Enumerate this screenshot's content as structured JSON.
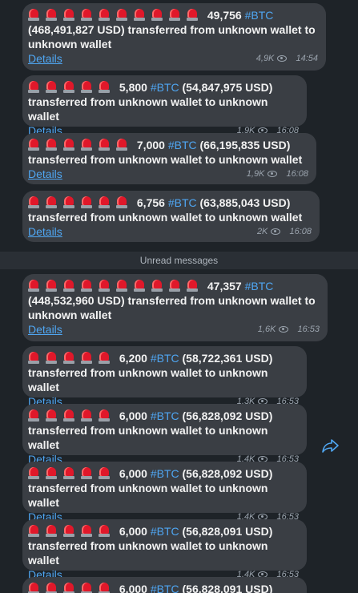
{
  "divider": "Unread messages",
  "messages": [
    {
      "sirens": 10,
      "amount": "49,756",
      "hashtag": "#BTC",
      "line1_rest": "",
      "line2": "(468,491,827 USD) transferred from unknown wallet to",
      "line3": "unknown wallet",
      "details": "Details",
      "views": "4,9K",
      "time": "14:54"
    },
    {
      "sirens": 5,
      "amount": "5,800",
      "hashtag": "#BTC",
      "line1_rest": "(54,847,975 USD)",
      "line2": "transferred from unknown wallet to unknown wallet",
      "details": "Details",
      "views": "1,9K",
      "time": "16:08"
    },
    {
      "sirens": 6,
      "amount": "7,000",
      "hashtag": "#BTC",
      "line1_rest": "(66,195,835 USD)",
      "line2": "transferred from unknown wallet to unknown wallet",
      "details": "Details",
      "views": "1,9K",
      "time": "16:08"
    },
    {
      "sirens": 6,
      "amount": "6,756",
      "hashtag": "#BTC",
      "line1_rest": "(63,885,043 USD)",
      "line2": "transferred from unknown wallet to unknown wallet",
      "details": "Details",
      "views": "2K",
      "time": "16:08"
    },
    {
      "sirens": 10,
      "amount": "47,357",
      "hashtag": "#BTC",
      "line1_rest": "",
      "line2": "(448,532,960 USD) transferred from unknown wallet to",
      "line3": "unknown wallet",
      "details": "Details",
      "views": "1,6K",
      "time": "16:53"
    },
    {
      "sirens": 5,
      "amount": "6,200",
      "hashtag": "#BTC",
      "line1_rest": "(58,722,361 USD)",
      "line2": "transferred from unknown wallet to unknown wallet",
      "details": "Details",
      "views": "1,3K",
      "time": "16:53"
    },
    {
      "sirens": 5,
      "amount": "6,000",
      "hashtag": "#BTC",
      "line1_rest": "(56,828,092 USD)",
      "line2": "transferred from unknown wallet to unknown wallet",
      "details": "Details",
      "views": "1,4K",
      "time": "16:53"
    },
    {
      "sirens": 5,
      "amount": "6,000",
      "hashtag": "#BTC",
      "line1_rest": "(56,828,092 USD)",
      "line2": "transferred from unknown wallet to unknown wallet",
      "details": "Details",
      "views": "1,4K",
      "time": "16:53"
    },
    {
      "sirens": 5,
      "amount": "6,000",
      "hashtag": "#BTC",
      "line1_rest": "(56,828,091 USD)",
      "line2": "transferred from unknown wallet to unknown wallet",
      "details": "Details",
      "views": "1,4K",
      "time": "16:53"
    },
    {
      "sirens": 5,
      "amount": "6,000",
      "hashtag": "#BTC",
      "line1_rest": "(56,828,091 USD)",
      "line2": "",
      "details": "",
      "views": "",
      "time": ""
    }
  ]
}
